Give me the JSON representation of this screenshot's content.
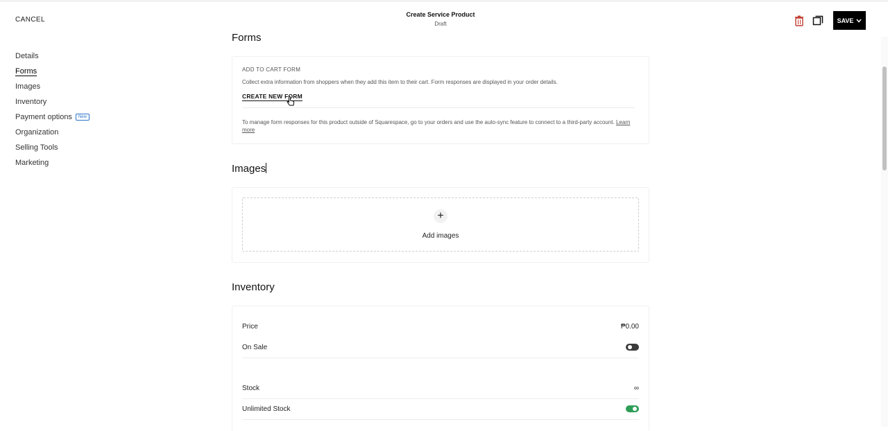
{
  "header": {
    "cancel_label": "CANCEL",
    "title": "Create Service Product",
    "subtitle": "Draft",
    "save_label": "SAVE"
  },
  "sidebar": {
    "items": [
      {
        "label": "Details"
      },
      {
        "label": "Forms",
        "active": true
      },
      {
        "label": "Images"
      },
      {
        "label": "Inventory"
      },
      {
        "label": "Payment options",
        "badge": "New"
      },
      {
        "label": "Organization"
      },
      {
        "label": "Selling Tools"
      },
      {
        "label": "Marketing"
      }
    ]
  },
  "forms": {
    "title": "Forms",
    "cart_form_label": "ADD TO CART FORM",
    "cart_form_desc": "Collect extra information from shoppers when they add this item to their cart. Form responses are displayed in your order details.",
    "create_form_label": "CREATE NEW FORM",
    "manage_text": "To manage form responses for this product outside of Squarespace, go to your orders and use the auto-sync feature to connect to a third-party account.",
    "learn_more": "Learn more"
  },
  "images": {
    "title": "Images",
    "add_label": "Add images",
    "plus_glyph": "+"
  },
  "inventory": {
    "title": "Inventory",
    "price_label": "Price",
    "price_value": "₱0.00",
    "on_sale_label": "On Sale",
    "on_sale": false,
    "stock_label": "Stock",
    "stock_value": "∞",
    "unlimited_label": "Unlimited Stock",
    "unlimited": true
  },
  "colors": {
    "accent_green": "#2e9e56",
    "toggle_off": "#3a3a3a",
    "trash_red": "#c0392b",
    "badge_blue": "#2a73c9"
  },
  "icons": {
    "trash": "trash-icon",
    "duplicate": "duplicate-icon",
    "chevron": "chevron-down-icon",
    "plus": "plus-icon"
  }
}
